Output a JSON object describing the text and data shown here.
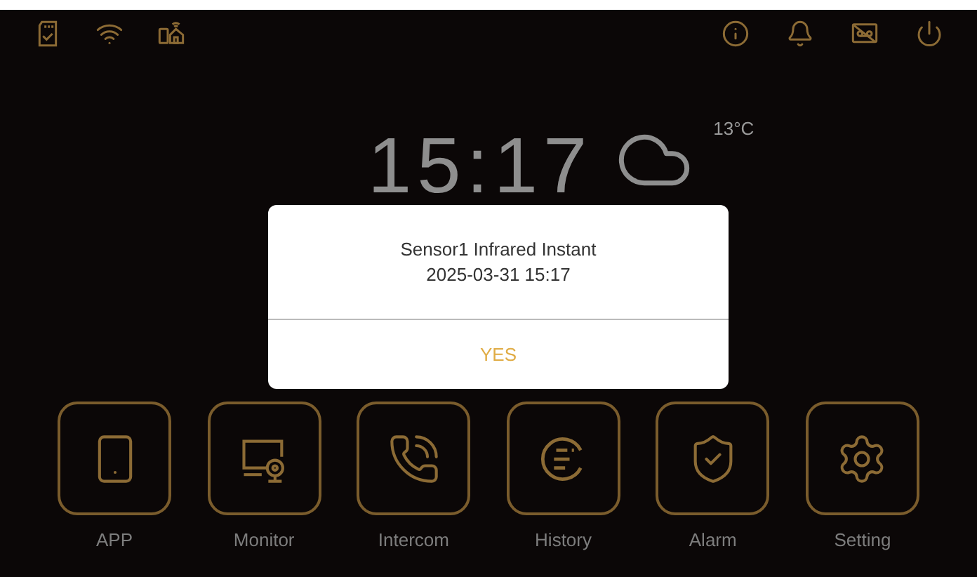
{
  "clock": {
    "time": "15:17"
  },
  "weather": {
    "temperature": "13°C"
  },
  "dialog": {
    "lines": [
      "Sensor1 Infrared Instant",
      "2025-03-31 15:17"
    ],
    "button": "YES"
  },
  "tiles": [
    {
      "kind": "app",
      "label": "APP"
    },
    {
      "kind": "monitor",
      "label": "Monitor"
    },
    {
      "kind": "intercom",
      "label": "Intercom"
    },
    {
      "kind": "history",
      "label": "History"
    },
    {
      "kind": "alarm",
      "label": "Alarm"
    },
    {
      "kind": "setting",
      "label": "Setting"
    }
  ]
}
